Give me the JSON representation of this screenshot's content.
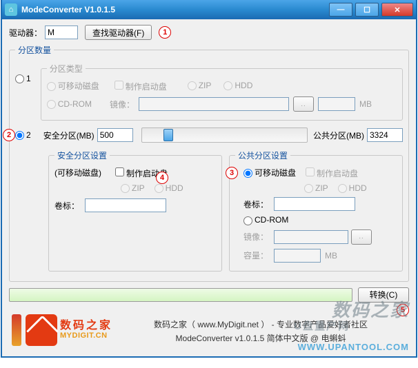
{
  "window": {
    "title": "ModeConverter V1.0.1.5"
  },
  "driver": {
    "label": "驱动器：",
    "value": "M",
    "find_btn": "查找驱动器(F)"
  },
  "markers": {
    "m1": "1",
    "m2": "2",
    "m3": "3",
    "m4": "4",
    "m5": "5"
  },
  "part_count": {
    "legend": "分区数量",
    "opt1": "1",
    "opt2": "2"
  },
  "part_type": {
    "legend": "分区类型",
    "removable": "可移动磁盘",
    "bootdisk": "制作启动盘",
    "zip": "ZIP",
    "hdd": "HDD",
    "cdrom": "CD-ROM",
    "image_lbl": "镜像：",
    "mb": "MB"
  },
  "split": {
    "safe_lbl": "安全分区(MB)",
    "safe_val": "500",
    "pub_lbl": "公共分区(MB)",
    "pub_val": "3324"
  },
  "safe": {
    "legend": "安全分区设置",
    "removable_note": "(可移动磁盘)",
    "bootdisk": "制作启动盘",
    "zip": "ZIP",
    "hdd": "HDD",
    "vol_lbl": "卷标：",
    "vol_val": ""
  },
  "pub": {
    "legend": "公共分区设置",
    "removable": "可移动磁盘",
    "bootdisk": "制作启动盘",
    "zip": "ZIP",
    "hdd": "HDD",
    "vol_lbl": "卷标：",
    "vol_val": "",
    "cdrom": "CD-ROM",
    "image_lbl": "镜像：",
    "cap_lbl": "容量：",
    "cap_val": "",
    "mb": "MB"
  },
  "convert_btn": "转换(C)",
  "credits": {
    "line1": "数码之家（ www.MyDigit.net ） - 专业数字产品爱好者社区",
    "line2": "ModeConverter v1.0.1.5 简体中文版 @ 电蝌蚪"
  },
  "logo": {
    "cn": "数码之家",
    "en": "MYDIGIT.CN"
  },
  "watermark": {
    "big": "数码之家",
    "site": "WWW.UPANTOOL.COM",
    "mid": "U盘量产网"
  }
}
